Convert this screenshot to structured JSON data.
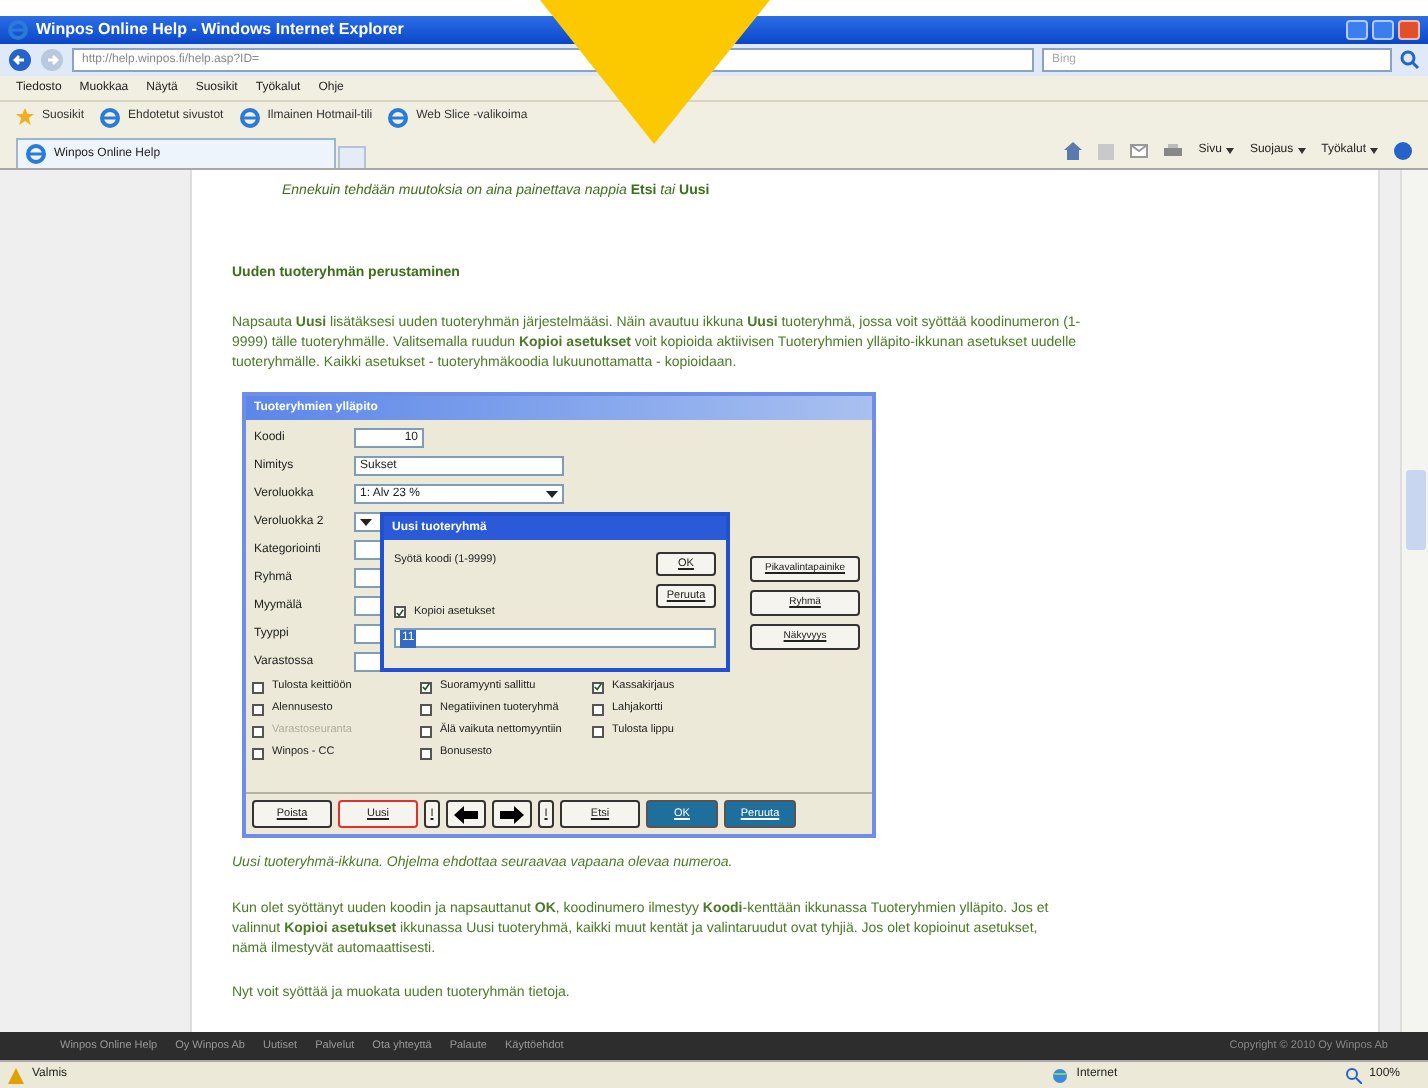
{
  "window": {
    "title": "Winpos Online Help - Windows Internet Explorer"
  },
  "address_bar": {
    "url": "http://help.winpos.fi/help.asp?ID=",
    "search_placeholder": "Bing"
  },
  "menu": [
    "Tiedosto",
    "Muokkaa",
    "Näytä",
    "Suosikit",
    "Työkalut",
    "Ohje"
  ],
  "favorites_bar": [
    {
      "label": "Suosikit",
      "kind": "star"
    },
    {
      "label": "Ehdotetut sivustot",
      "kind": "ie"
    },
    {
      "label": "Ilmainen Hotmail-tili",
      "kind": "ie"
    },
    {
      "label": "Web Slice -valikoima",
      "kind": "ie"
    }
  ],
  "tabs": [
    {
      "label": "Winpos Online Help",
      "selected": true
    }
  ],
  "command_bar": [
    "Sivu",
    "Suojaus",
    "Työkalut"
  ],
  "page": {
    "note": "*Ennekuin tehdään muutoksia on aina painettava nappia* **Etsi** *tai* **Uusi**",
    "heading": "Uuden tuoteryhmän perustaminen",
    "intro": "Napsauta **Uusi** lisätäksesi uuden tuoteryhmän järjestelmääsi. Näin avautuu ikkuna **Uusi** tuoteryhmä, jossa voit syöttää koodinumeron (1-9999) tälle tuoteryhmälle. Valitsemalla ruudun **Kopioi asetukset** voit kopioida aktiivisen Tuoteryhmien ylläpito-ikkunan asetukset uudelle tuoteryhmälle. Kaikki asetukset - tuoteryhmäkoodia lukuunottamatta - kopioidaan.",
    "dialog": {
      "title": "Tuoteryhmien ylläpito",
      "fields": [
        {
          "label": "Koodi",
          "value": "10",
          "kind": "number"
        },
        {
          "label": "Nimitys",
          "value": "Sukset",
          "kind": "text"
        },
        {
          "label": "Veroluokka",
          "value": "1: Alv 23 %",
          "kind": "select"
        },
        {
          "label": "Veroluokka 2",
          "kind": "select"
        },
        {
          "label": "Kategoriointi",
          "kind": "short"
        },
        {
          "label": "Ryhmä",
          "kind": "short"
        },
        {
          "label": "Myymälä",
          "kind": "short"
        },
        {
          "label": "Tyyppi",
          "kind": "short"
        },
        {
          "label": "Varastossa",
          "kind": "short"
        }
      ],
      "side_buttons": [
        "Pikavalintapainike",
        "Ryhmä",
        "Näkyvyys"
      ],
      "checkbox_columns": [
        [
          {
            "label": "Tulosta keittiöön",
            "checked": false,
            "disabled": false
          },
          {
            "label": "Alennusesto",
            "checked": false,
            "disabled": false
          },
          {
            "label": "Varastoseuranta",
            "checked": false,
            "disabled": true
          },
          {
            "label": "Winpos - CC",
            "checked": false,
            "disabled": false
          }
        ],
        [
          {
            "label": "Suoramyynti sallittu",
            "checked": true,
            "disabled": false
          },
          {
            "label": "Negatiivinen tuoteryhmä",
            "checked": false,
            "disabled": false
          },
          {
            "label": "Älä vaikuta nettomyyntiin",
            "checked": false,
            "disabled": false
          },
          {
            "label": "Bonusesto",
            "checked": false,
            "disabled": false
          }
        ],
        [
          {
            "label": "Kassakirjaus",
            "checked": true,
            "disabled": false
          },
          {
            "label": "Lahjakortti",
            "checked": false,
            "disabled": false
          },
          {
            "label": "Tulosta lippu",
            "checked": false,
            "disabled": false
          }
        ]
      ],
      "buttons": [
        {
          "label": "Poista",
          "kind": "plain"
        },
        {
          "label": "Uusi",
          "kind": "highlighted"
        },
        {
          "label": "I",
          "kind": "small"
        },
        {
          "kind": "left"
        },
        {
          "kind": "right"
        },
        {
          "label": "I",
          "kind": "small"
        },
        {
          "label": "Etsi",
          "kind": "plain"
        },
        {
          "label": "OK",
          "kind": "primary"
        },
        {
          "label": "Peruuta",
          "kind": "primary"
        }
      ],
      "popup": {
        "title": "Uusi tuoteryhmä",
        "prompt": "Syötä koodi (1-9999)",
        "buttons": [
          "OK",
          "Peruuta"
        ],
        "copy_settings": {
          "label": "Kopioi asetukset",
          "checked": true
        },
        "value": "11"
      }
    },
    "caption": "Uusi tuoteryhmä-ikkuna. Ohjelma ehdottaa seuraavaa vapaana olevaa numeroa.",
    "paragraphs": [
      "Kun olet syöttänyt uuden koodin ja napsauttanut **OK**, koodinumero ilmestyy **Koodi**-kenttään ikkunassa Tuoteryhmien ylläpito. Jos et valinnut **Kopioi asetukset** ikkunassa Uusi tuoteryhmä, kaikki muut kentät ja valintaruudut ovat tyhjiä. Jos olet kopioinut asetukset, nämä ilmestyvät automaattisesti.",
      "Nyt voit syöttää ja muokata uuden tuoteryhmän tietoja."
    ]
  },
  "footer": {
    "links": [
      "Winpos Online Help",
      "Oy Winpos Ab",
      "Uutiset",
      "Palvelut",
      "Ota yhteyttä",
      "Palaute",
      "Käyttöehdot"
    ],
    "copyright": "Copyright © 2010 Oy Winpos Ab"
  },
  "status_bar": {
    "text": "Valmis",
    "zone": "Internet",
    "zoom": "100%"
  }
}
